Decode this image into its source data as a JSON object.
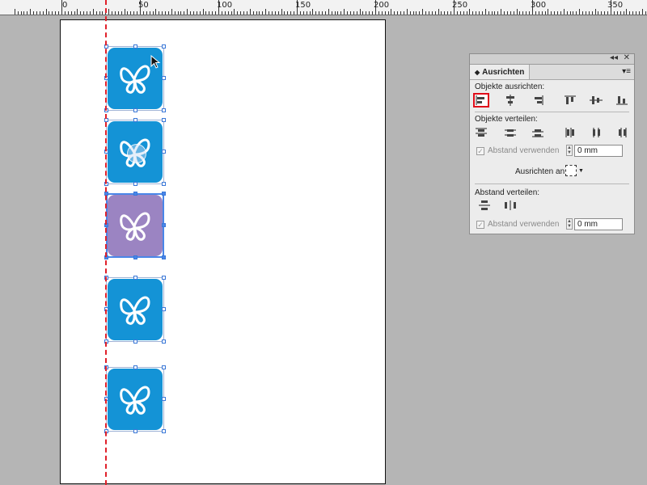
{
  "ruler": {
    "labels": [
      "0",
      "50",
      "100",
      "150",
      "200",
      "250",
      "300",
      "350"
    ]
  },
  "icons": {
    "count": 5,
    "selected_index": 2,
    "colors": {
      "normal": "#1493d6",
      "selected": "#9b84c2",
      "glyph": "#ffffff"
    }
  },
  "panel": {
    "tab_title": "Ausrichten",
    "collapse_glyph": "◂◂",
    "close_glyph": "✕",
    "menu_glyph": "▾≡",
    "align_objects": {
      "label": "Objekte ausrichten:",
      "buttons": [
        "align-left-edges-icon",
        "align-horizontal-centers-icon",
        "align-right-edges-icon",
        "align-top-edges-icon",
        "align-vertical-centers-icon",
        "align-bottom-edges-icon"
      ],
      "active_index": 0
    },
    "distribute_objects": {
      "label": "Objekte verteilen:",
      "buttons": [
        "distribute-top-icon",
        "distribute-vertical-center-icon",
        "distribute-bottom-icon",
        "distribute-left-icon",
        "distribute-horizontal-center-icon",
        "distribute-right-icon"
      ],
      "use_spacing_label": "Abstand verwenden",
      "spacing_value": "0 mm"
    },
    "align_to": {
      "label": "Ausrichten an:"
    },
    "distribute_spacing": {
      "label": "Abstand verteilen:",
      "buttons": [
        "distribute-vertical-space-icon",
        "distribute-horizontal-space-icon"
      ],
      "use_spacing_label": "Abstand verwenden",
      "spacing_value": "0 mm"
    },
    "accent_color": "#e00d1a"
  }
}
